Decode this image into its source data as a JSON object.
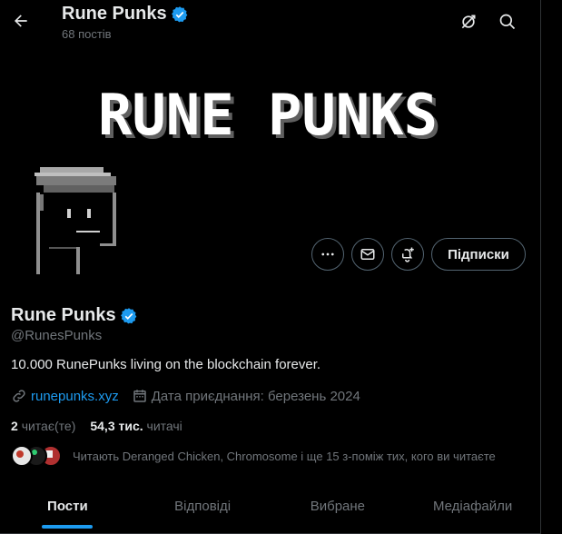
{
  "header": {
    "title": "Rune Punks",
    "posts_count": "68 постів",
    "accent_color": "#1d9bf0",
    "icons": [
      "back-arrow-icon",
      "verified-badge-icon",
      "grok-icon",
      "search-icon"
    ]
  },
  "banner": {
    "text": "RUNE PUNKS"
  },
  "actions": {
    "more_icon": "more-icon",
    "message_icon": "envelope-icon",
    "notify_icon": "bell-plus-icon",
    "follow_label": "Підписки"
  },
  "profile": {
    "name": "Rune Punks",
    "handle": "@RunesPunks",
    "bio": "10.000 RunePunks living on the blockchain forever.",
    "website": "runepunks.xyz",
    "joined": "Дата приєднання: березень 2024"
  },
  "stats": {
    "following_count": "2",
    "following_label": "читає(те)",
    "followers_count": "54,3 тис.",
    "followers_label": "читачі"
  },
  "followers_you_know": "Читають Deranged Chicken, Chromosome і ще 15 з-поміж тих, кого ви читаєте",
  "tabs": [
    {
      "label": "Пости",
      "active": true
    },
    {
      "label": "Відповіді",
      "active": false
    },
    {
      "label": "Вибране",
      "active": false
    },
    {
      "label": "Медіафайли",
      "active": false
    }
  ]
}
